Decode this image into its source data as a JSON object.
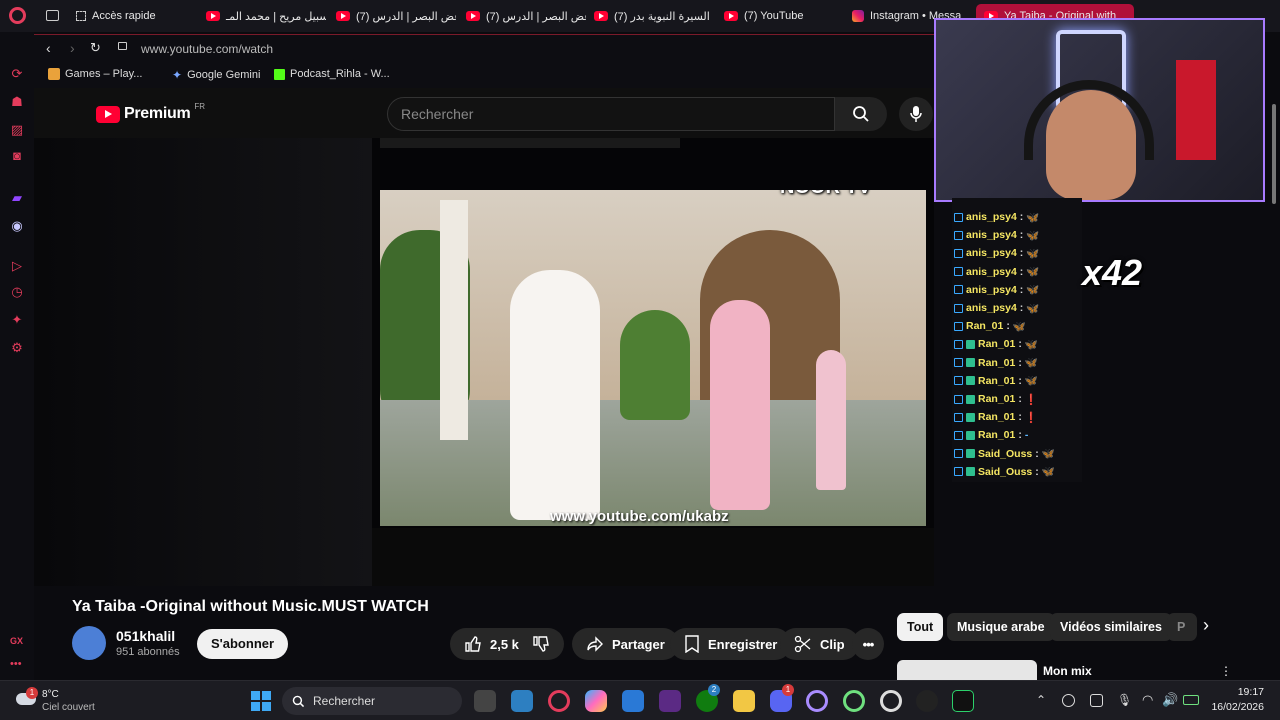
{
  "tabs": [
    {
      "label": "Accès rapide"
    },
    {
      "label": "سبيل مريح | محمد المـ"
    },
    {
      "label": "(7) غض البصر | الدرس"
    },
    {
      "label": "(7) غض البصر | الدرس"
    },
    {
      "label": "(7) السيرة النبوية بدر"
    },
    {
      "label": "(7) YouTube"
    },
    {
      "label": "Instagram • Messa"
    },
    {
      "label": "Ya Taiba - Original with"
    }
  ],
  "url": "www.youtube.com/watch",
  "bookmarks": [
    "Games – Play...",
    "Google Gemini",
    "Podcast_Rihla - W..."
  ],
  "youtube": {
    "logo_text": "Premium",
    "logo_region": "FR",
    "search_placeholder": "Rechercher"
  },
  "video": {
    "channel_watermark": "NOOR TV",
    "url_overlay": "www.youtube.com/ukabz",
    "title": "Ya Taiba -Original without Music.MUST WATCH",
    "channel_name": "051khalil",
    "subscribers": "951 abonnés",
    "subscribe_label": "S'abonner",
    "likes": "2,5 k",
    "share_label": "Partager",
    "save_label": "Enregistrer",
    "clip_label": "Clip"
  },
  "chips": [
    "Tout",
    "Musique arabe",
    "Vidéos similaires",
    "P"
  ],
  "up_next_title": "Mon mix",
  "chat": [
    {
      "user": "anis_psy4",
      "msg": "🦋",
      "color": "#f5e663"
    },
    {
      "user": "anis_psy4",
      "msg": "🦋",
      "color": "#f5e663"
    },
    {
      "user": "anis_psy4",
      "msg": "🦋",
      "color": "#f5e663"
    },
    {
      "user": "anis_psy4",
      "msg": "🦋",
      "color": "#f5e663"
    },
    {
      "user": "anis_psy4",
      "msg": "🦋",
      "color": "#f5e663"
    },
    {
      "user": "anis_psy4",
      "msg": "🦋",
      "color": "#f5e663"
    },
    {
      "user": "Ran_01",
      "msg": "🦋",
      "color": "#f5e663"
    },
    {
      "user": "Ran_01",
      "msg": "🦋",
      "color": "#f5e663"
    },
    {
      "user": "Ran_01",
      "msg": "🦋",
      "color": "#f5e663"
    },
    {
      "user": "Ran_01",
      "msg": "🦋",
      "color": "#f5e663"
    },
    {
      "user": "Ran_01",
      "msg": "❗",
      "color": "#f5e663"
    },
    {
      "user": "Ran_01",
      "msg": "❗",
      "color": "#f5e663"
    },
    {
      "user": "Ran_01",
      "msg": "-",
      "color": "#f5e663"
    },
    {
      "user": "Said_Ouss",
      "msg": "🦋",
      "color": "#f5e663"
    },
    {
      "user": "Said_Ouss",
      "msg": "🦋",
      "color": "#f5e663"
    }
  ],
  "chat_separator": ":",
  "overlay_counter": "x42",
  "taskbar": {
    "weather_temp": "8°C",
    "weather_desc": "Ciel couvert",
    "search_label": "Rechercher",
    "time": "19:17",
    "date": "16/02/2026",
    "weather_badge": "1",
    "xbox_badge": "2",
    "discord_badge": "1"
  },
  "sidebar_gx": "GX",
  "colors": {
    "accent": "#e43c5c",
    "yt_red": "#ff0033",
    "chat_name": "#f5e663",
    "cam_border": "#a87bff"
  },
  "icons": [
    "back-icon",
    "forward-icon",
    "reload-icon",
    "lock-icon",
    "search-icon",
    "mic-icon",
    "like-icon",
    "dislike-icon",
    "share-icon",
    "save-icon",
    "clip-icon",
    "more-icon",
    "chevron-right-icon",
    "windows-start-icon"
  ]
}
